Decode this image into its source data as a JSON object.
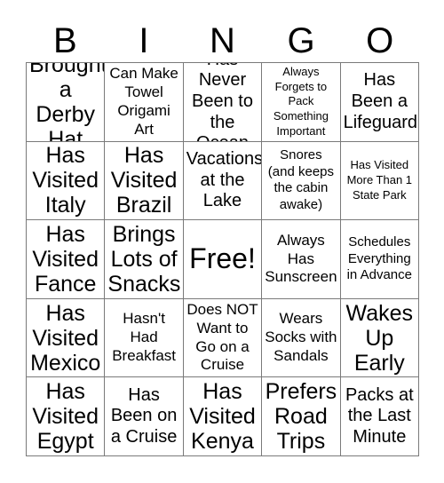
{
  "card": {
    "title_letters": [
      "B",
      "I",
      "N",
      "G",
      "O"
    ],
    "rows": [
      [
        {
          "text": "Brought a Derby Hat",
          "size": "s-xl"
        },
        {
          "text": "Can Make Towel Origami Art",
          "size": "s-md"
        },
        {
          "text": "Has Never Been to the Ocean",
          "size": "s-lg"
        },
        {
          "text": "Always Forgets to Pack Something Important",
          "size": "s-xs"
        },
        {
          "text": "Has Been a Lifeguard",
          "size": "s-lg"
        }
      ],
      [
        {
          "text": "Has Visited Italy",
          "size": "s-xl"
        },
        {
          "text": "Has Visited Brazil",
          "size": "s-xl"
        },
        {
          "text": "Vacations at the Lake",
          "size": "s-lg"
        },
        {
          "text": "Snores (and keeps the cabin awake)",
          "size": "s-sm"
        },
        {
          "text": "Has Visited More Than 1 State Park",
          "size": "s-xs"
        }
      ],
      [
        {
          "text": "Has Visited Fance",
          "size": "s-xl"
        },
        {
          "text": "Brings Lots of Snacks",
          "size": "s-xl"
        },
        {
          "text": "Free!",
          "size": "s-free"
        },
        {
          "text": "Always Has Sunscreen",
          "size": "s-md"
        },
        {
          "text": "Schedules Everything in Advance",
          "size": "s-sm"
        }
      ],
      [
        {
          "text": "Has Visited Mexico",
          "size": "s-xl"
        },
        {
          "text": "Hasn't Had Breakfast",
          "size": "s-md"
        },
        {
          "text": "Does NOT Want to Go on a Cruise",
          "size": "s-md"
        },
        {
          "text": "Wears Socks with Sandals",
          "size": "s-md"
        },
        {
          "text": "Wakes Up Early",
          "size": "s-xl"
        }
      ],
      [
        {
          "text": "Has Visited Egypt",
          "size": "s-xl"
        },
        {
          "text": "Has Been on a Cruise",
          "size": "s-lg"
        },
        {
          "text": "Has Visited Kenya",
          "size": "s-xl"
        },
        {
          "text": "Prefers Road Trips",
          "size": "s-xl"
        },
        {
          "text": "Packs at the Last Minute",
          "size": "s-lg"
        }
      ]
    ],
    "colors": {
      "background": "#ffffff",
      "text": "#000000",
      "grid_line": "#7a7a7a"
    }
  }
}
